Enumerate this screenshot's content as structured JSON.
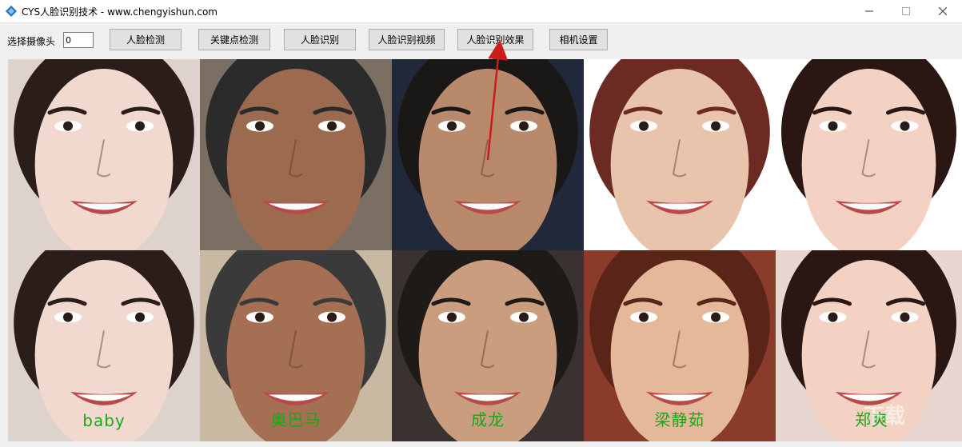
{
  "window": {
    "title": "CYS人脸识别技术  -  www.chengyishun.com",
    "minimize": "—",
    "maximize": "☐",
    "close": "✕"
  },
  "toolbar": {
    "camera_label": "选择摄像头",
    "camera_value": "0",
    "buttons": [
      {
        "label": "人脸检测"
      },
      {
        "label": "关键点检测"
      },
      {
        "label": "人脸识别"
      },
      {
        "label": "人脸识别视频"
      },
      {
        "label": "人脸识别效果"
      },
      {
        "label": "相机设置"
      }
    ]
  },
  "gallery": {
    "top_row": [
      {
        "skin": "#f1d9cf",
        "hair": "#2a1d1a",
        "bg": "#ded3cc"
      },
      {
        "skin": "#9c6b4f",
        "hair": "#2b2b2b",
        "bg": "#7b6f64"
      },
      {
        "skin": "#b8896b",
        "hair": "#1a1717",
        "bg": "#20283a"
      },
      {
        "skin": "#e9c4ad",
        "hair": "#6b2b22",
        "bg": "#ffffff"
      },
      {
        "skin": "#f3d2c4",
        "hair": "#2a1714",
        "bg": "#ffffff"
      }
    ],
    "bottom_row": [
      {
        "skin": "#f1d9cf",
        "hair": "#2a1d1a",
        "bg": "#ded3cc",
        "name": "baby"
      },
      {
        "skin": "#a46f52",
        "hair": "#3a3a3a",
        "bg": "#c9b9a3",
        "name": "奥巴马"
      },
      {
        "skin": "#c99d7e",
        "hair": "#1e1a18",
        "bg": "#3a3230",
        "name": "成龙"
      },
      {
        "skin": "#e5b89a",
        "hair": "#5a2418",
        "bg": "#8a3b2a",
        "name": "梁静茹"
      },
      {
        "skin": "#f3d2c4",
        "hair": "#2a1714",
        "bg": "#e8d6d0",
        "name": "郑爽"
      }
    ]
  },
  "watermark": "下载"
}
